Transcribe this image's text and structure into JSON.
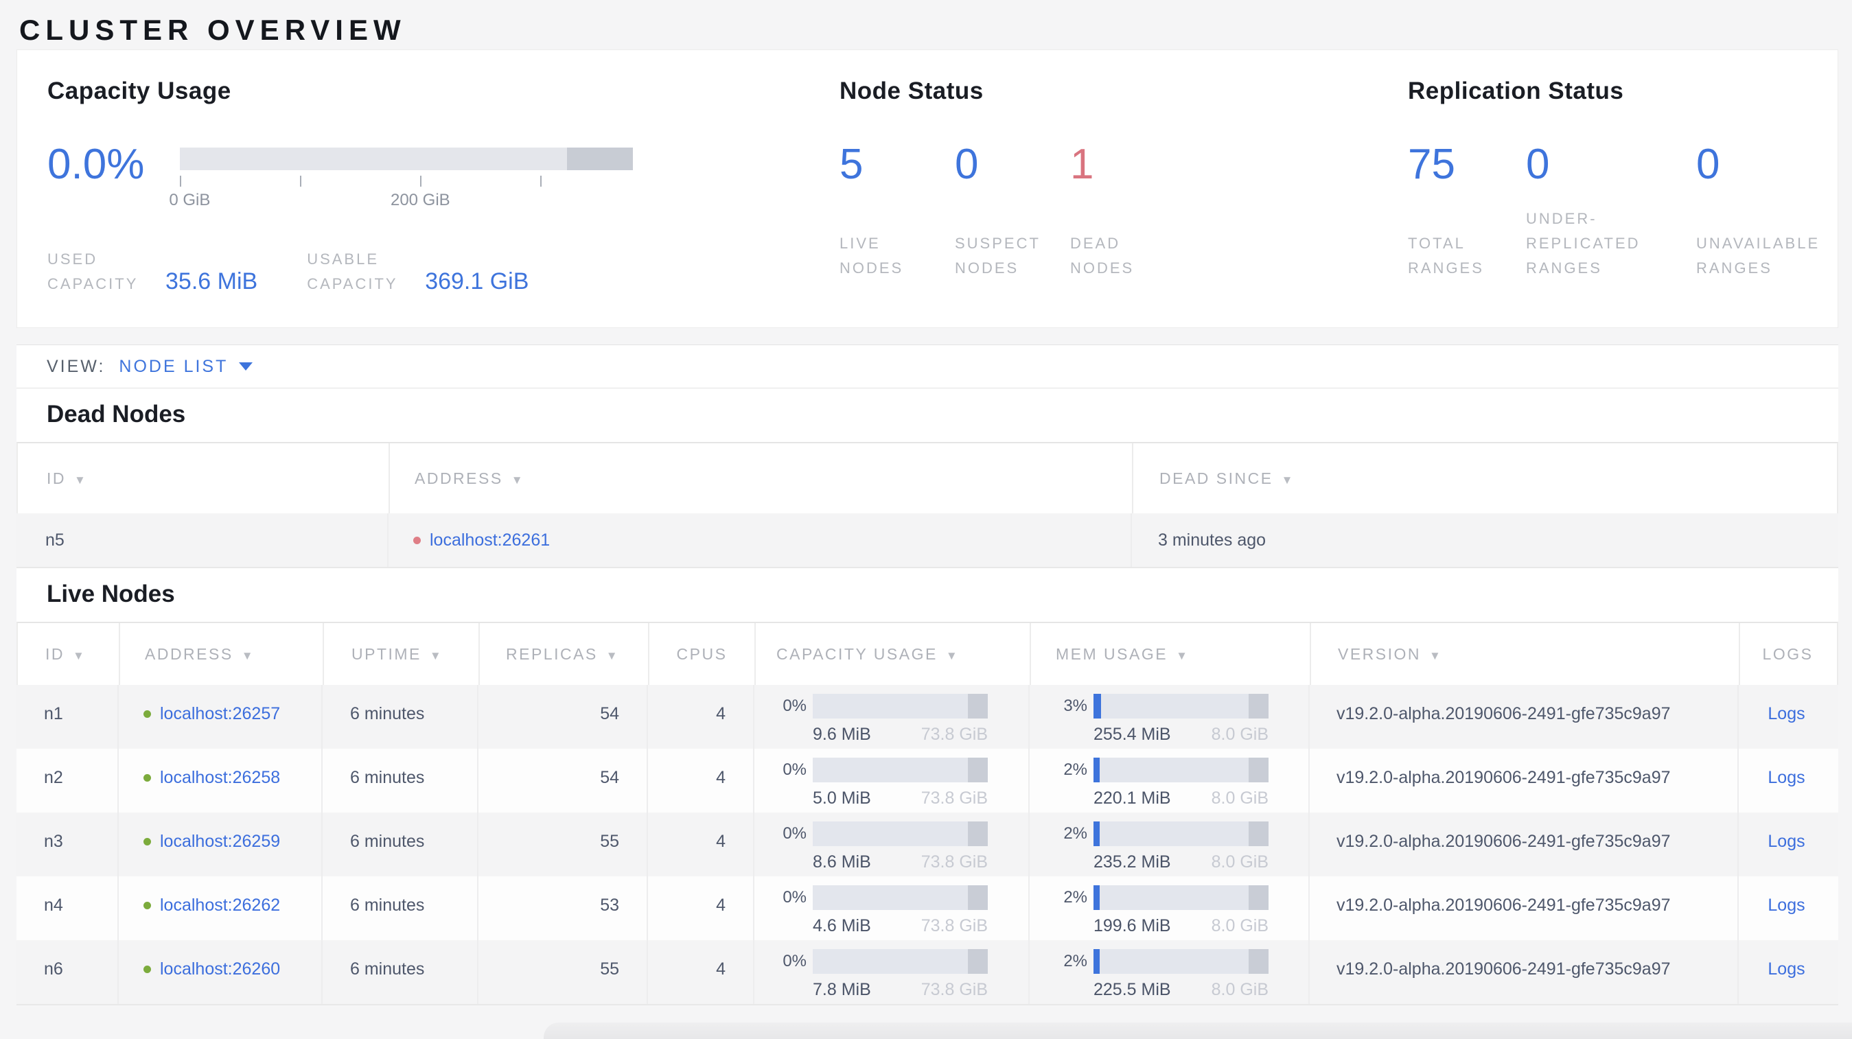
{
  "title": "CLUSTER OVERVIEW",
  "colors": {
    "accent_blue": "#3e74dc",
    "danger_red": "#d9747f",
    "live_dot_green": "#7cab3c",
    "dead_dot_red": "#df7e86",
    "muted_label_gray": "#b4b7bd",
    "table_text_slate": "#4e576b"
  },
  "summary": {
    "capacity": {
      "title": "Capacity Usage",
      "percent": "0.0%",
      "tick_labels": [
        "0 GiB",
        "200 GiB"
      ],
      "stats": [
        {
          "label": "USED CAPACITY",
          "value": "35.6 MiB"
        },
        {
          "label": "USABLE CAPACITY",
          "value": "369.1 GiB"
        }
      ]
    },
    "node_status": {
      "title": "Node Status",
      "stats": [
        {
          "value": "5",
          "label": "LIVE NODES"
        },
        {
          "value": "0",
          "label": "SUSPECT NODES"
        },
        {
          "value": "1",
          "label": "DEAD NODES"
        }
      ]
    },
    "replication": {
      "title": "Replication Status",
      "stats": [
        {
          "value": "75",
          "label": "TOTAL RANGES"
        },
        {
          "value": "0",
          "label": "UNDER-REPLICATED RANGES"
        },
        {
          "value": "0",
          "label": "UNAVAILABLE RANGES"
        }
      ]
    }
  },
  "view_bar": {
    "label": "VIEW:",
    "selected": "NODE LIST"
  },
  "dead_nodes": {
    "title": "Dead Nodes",
    "columns": [
      "ID",
      "ADDRESS",
      "DEAD SINCE"
    ],
    "rows": [
      {
        "id": "n5",
        "address": "localhost:26261",
        "dead_since": "3 minutes ago"
      }
    ]
  },
  "live_nodes": {
    "title": "Live Nodes",
    "columns": [
      "ID",
      "ADDRESS",
      "UPTIME",
      "REPLICAS",
      "CPUS",
      "CAPACITY USAGE",
      "MEM USAGE",
      "VERSION",
      "LOGS"
    ],
    "rows": [
      {
        "id": "n1",
        "address": "localhost:26257",
        "uptime": "6 minutes",
        "replicas": "54",
        "cpus": "4",
        "capacity": {
          "pct": "0%",
          "used": "9.6 MiB",
          "total": "73.8 GiB"
        },
        "memory": {
          "pct": "3%",
          "used": "255.4 MiB",
          "total": "8.0 GiB"
        },
        "version": "v19.2.0-alpha.20190606-2491-gfe735c9a97",
        "logs": "Logs"
      },
      {
        "id": "n2",
        "address": "localhost:26258",
        "uptime": "6 minutes",
        "replicas": "54",
        "cpus": "4",
        "capacity": {
          "pct": "0%",
          "used": "5.0 MiB",
          "total": "73.8 GiB"
        },
        "memory": {
          "pct": "2%",
          "used": "220.1 MiB",
          "total": "8.0 GiB"
        },
        "version": "v19.2.0-alpha.20190606-2491-gfe735c9a97",
        "logs": "Logs"
      },
      {
        "id": "n3",
        "address": "localhost:26259",
        "uptime": "6 minutes",
        "replicas": "55",
        "cpus": "4",
        "capacity": {
          "pct": "0%",
          "used": "8.6 MiB",
          "total": "73.8 GiB"
        },
        "memory": {
          "pct": "2%",
          "used": "235.2 MiB",
          "total": "8.0 GiB"
        },
        "version": "v19.2.0-alpha.20190606-2491-gfe735c9a97",
        "logs": "Logs"
      },
      {
        "id": "n4",
        "address": "localhost:26262",
        "uptime": "6 minutes",
        "replicas": "53",
        "cpus": "4",
        "capacity": {
          "pct": "0%",
          "used": "4.6 MiB",
          "total": "73.8 GiB"
        },
        "memory": {
          "pct": "2%",
          "used": "199.6 MiB",
          "total": "8.0 GiB"
        },
        "version": "v19.2.0-alpha.20190606-2491-gfe735c9a97",
        "logs": "Logs"
      },
      {
        "id": "n6",
        "address": "localhost:26260",
        "uptime": "6 minutes",
        "replicas": "55",
        "cpus": "4",
        "capacity": {
          "pct": "0%",
          "used": "7.8 MiB",
          "total": "73.8 GiB"
        },
        "memory": {
          "pct": "2%",
          "used": "225.5 MiB",
          "total": "8.0 GiB"
        },
        "version": "v19.2.0-alpha.20190606-2491-gfe735c9a97",
        "logs": "Logs"
      }
    ]
  }
}
